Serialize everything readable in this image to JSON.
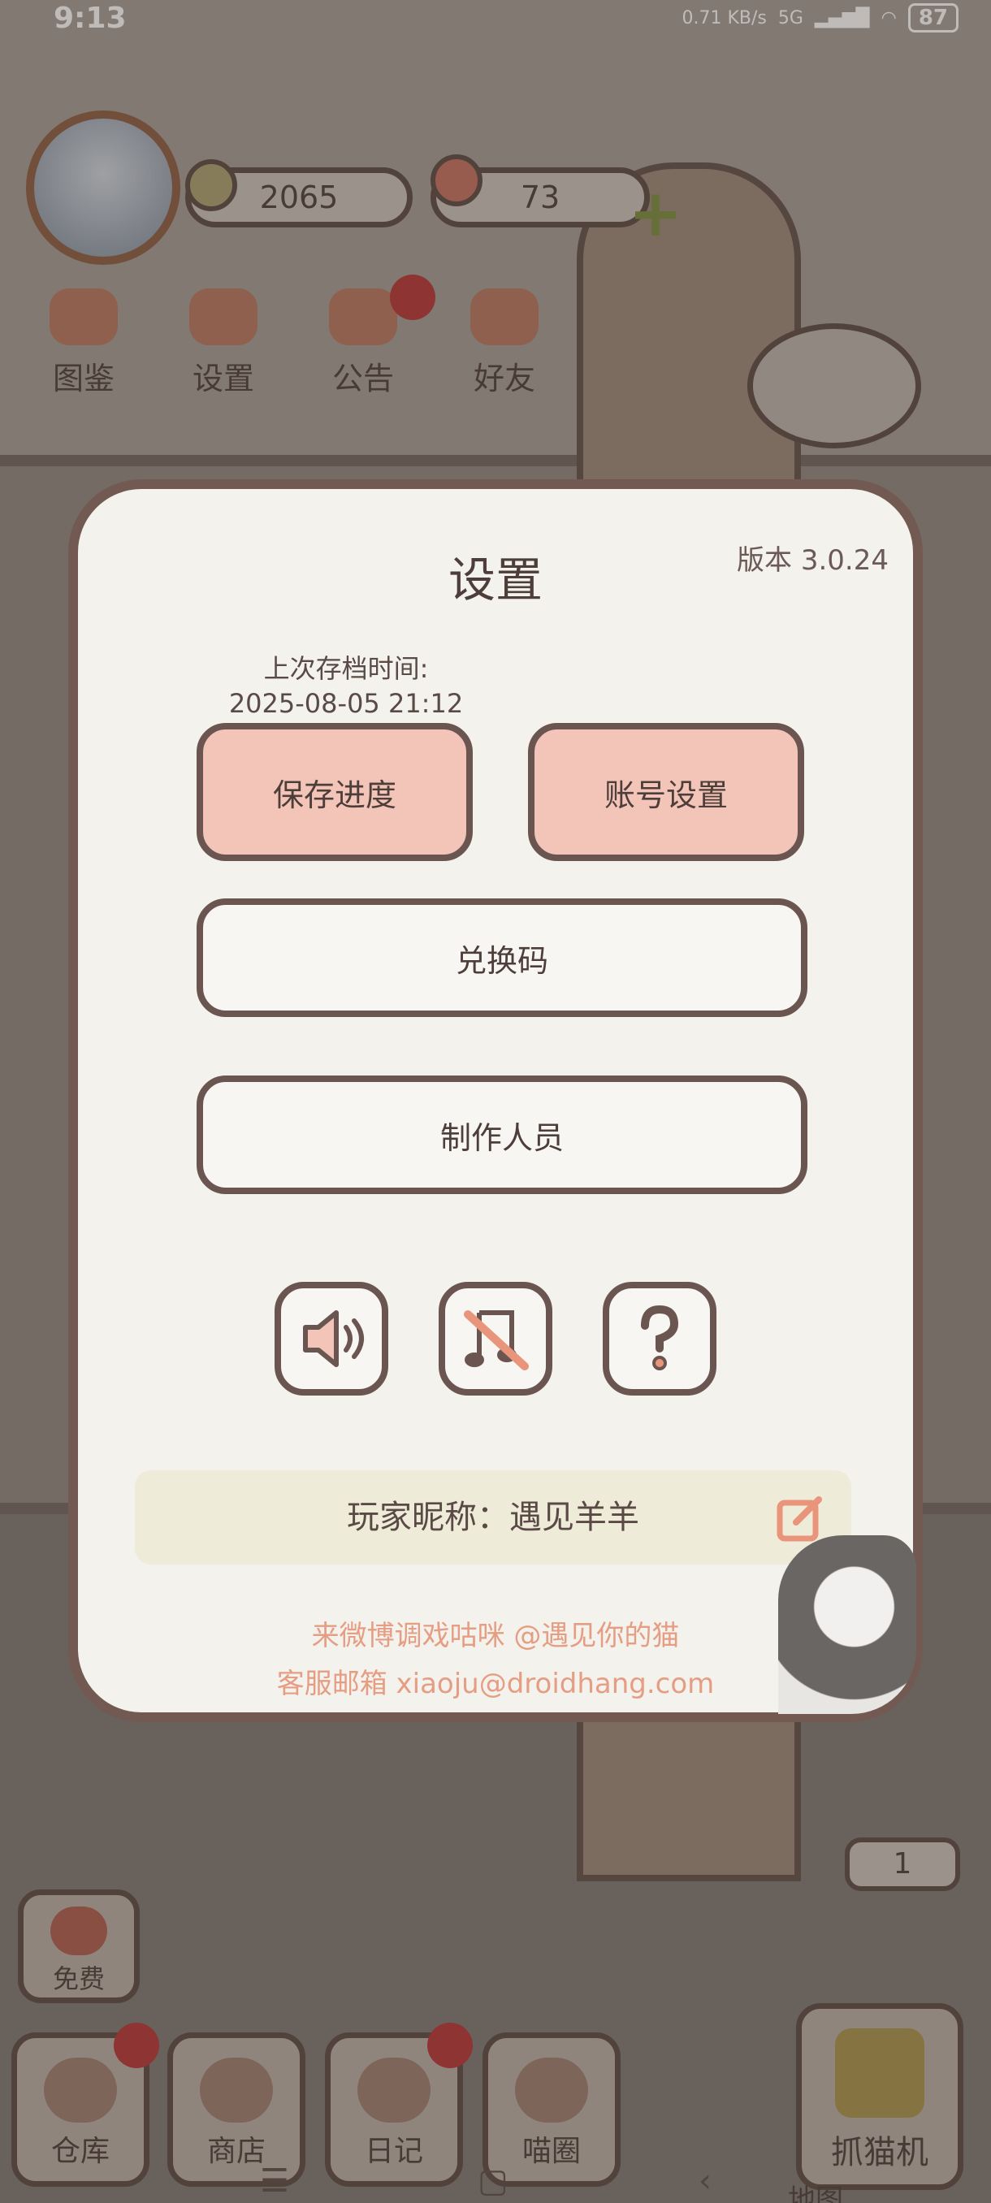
{
  "status_bar": {
    "time": "9:13",
    "speed": "0.71 KB/s",
    "network": "5G",
    "battery": "87"
  },
  "hud": {
    "fish_count": "2065",
    "heart_count": "73"
  },
  "top_nav": [
    {
      "label": "图鉴"
    },
    {
      "label": "设置"
    },
    {
      "label": "公告"
    },
    {
      "label": "好友"
    }
  ],
  "settings_dialog": {
    "title": "设置",
    "version": "版本 3.0.24",
    "last_save_label": "上次存档时间:",
    "last_save_time": "2025-08-05 21:12",
    "save_progress": "保存进度",
    "account_settings": "账号设置",
    "redeem_code": "兑换码",
    "credits": "制作人员",
    "nickname": "玩家昵称：遇见羊羊",
    "weibo_line": "来微博调戏咕咪 @遇见你的猫",
    "email_line": "客服邮箱 xiaoju@droidhang.com"
  },
  "bottom_nav": {
    "free": "免费",
    "warehouse": "仓库",
    "shop": "商店",
    "diary": "日记",
    "circle": "喵圈",
    "claw_machine": "抓猫机",
    "claw_count": "1",
    "map": "地图"
  },
  "colors": {
    "dialog_bg": "#f4f2ec",
    "pink_button": "#f3c4b8",
    "border": "#6b5550",
    "footer_text": "#e59d83"
  }
}
